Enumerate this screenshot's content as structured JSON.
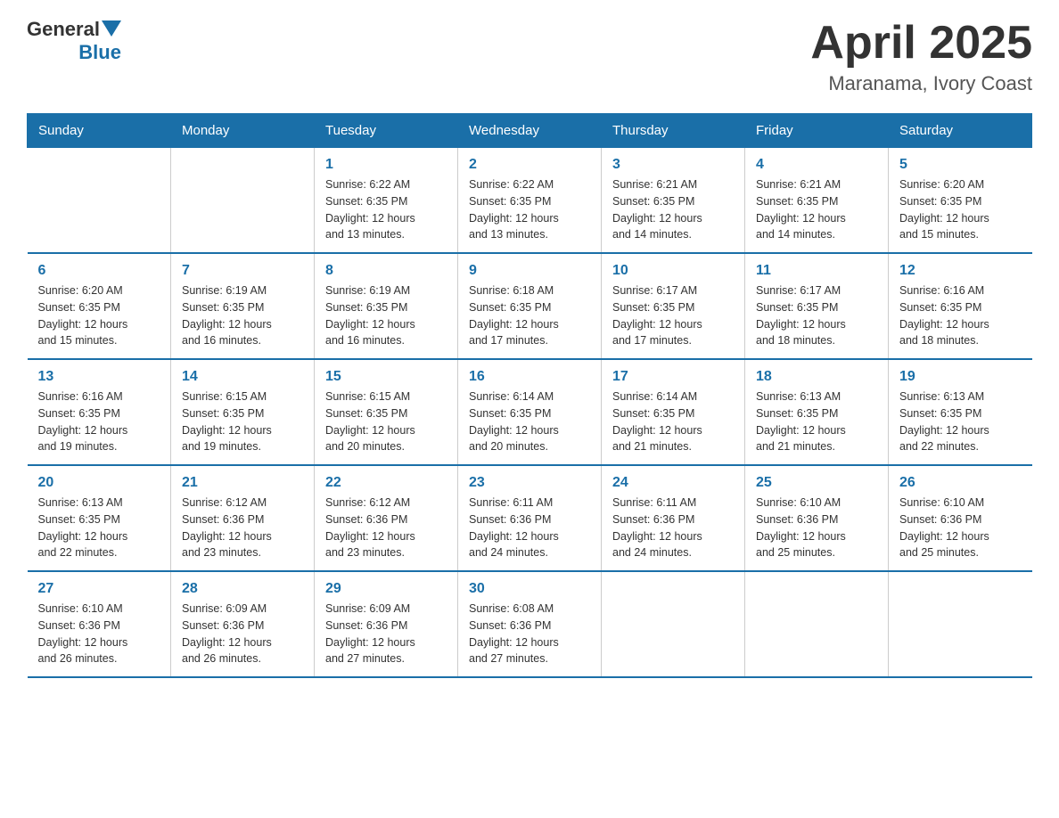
{
  "header": {
    "logo_general": "General",
    "logo_blue": "Blue",
    "month": "April 2025",
    "location": "Maranama, Ivory Coast"
  },
  "weekdays": [
    "Sunday",
    "Monday",
    "Tuesday",
    "Wednesday",
    "Thursday",
    "Friday",
    "Saturday"
  ],
  "weeks": [
    [
      {
        "day": "",
        "info": ""
      },
      {
        "day": "",
        "info": ""
      },
      {
        "day": "1",
        "info": "Sunrise: 6:22 AM\nSunset: 6:35 PM\nDaylight: 12 hours\nand 13 minutes."
      },
      {
        "day": "2",
        "info": "Sunrise: 6:22 AM\nSunset: 6:35 PM\nDaylight: 12 hours\nand 13 minutes."
      },
      {
        "day": "3",
        "info": "Sunrise: 6:21 AM\nSunset: 6:35 PM\nDaylight: 12 hours\nand 14 minutes."
      },
      {
        "day": "4",
        "info": "Sunrise: 6:21 AM\nSunset: 6:35 PM\nDaylight: 12 hours\nand 14 minutes."
      },
      {
        "day": "5",
        "info": "Sunrise: 6:20 AM\nSunset: 6:35 PM\nDaylight: 12 hours\nand 15 minutes."
      }
    ],
    [
      {
        "day": "6",
        "info": "Sunrise: 6:20 AM\nSunset: 6:35 PM\nDaylight: 12 hours\nand 15 minutes."
      },
      {
        "day": "7",
        "info": "Sunrise: 6:19 AM\nSunset: 6:35 PM\nDaylight: 12 hours\nand 16 minutes."
      },
      {
        "day": "8",
        "info": "Sunrise: 6:19 AM\nSunset: 6:35 PM\nDaylight: 12 hours\nand 16 minutes."
      },
      {
        "day": "9",
        "info": "Sunrise: 6:18 AM\nSunset: 6:35 PM\nDaylight: 12 hours\nand 17 minutes."
      },
      {
        "day": "10",
        "info": "Sunrise: 6:17 AM\nSunset: 6:35 PM\nDaylight: 12 hours\nand 17 minutes."
      },
      {
        "day": "11",
        "info": "Sunrise: 6:17 AM\nSunset: 6:35 PM\nDaylight: 12 hours\nand 18 minutes."
      },
      {
        "day": "12",
        "info": "Sunrise: 6:16 AM\nSunset: 6:35 PM\nDaylight: 12 hours\nand 18 minutes."
      }
    ],
    [
      {
        "day": "13",
        "info": "Sunrise: 6:16 AM\nSunset: 6:35 PM\nDaylight: 12 hours\nand 19 minutes."
      },
      {
        "day": "14",
        "info": "Sunrise: 6:15 AM\nSunset: 6:35 PM\nDaylight: 12 hours\nand 19 minutes."
      },
      {
        "day": "15",
        "info": "Sunrise: 6:15 AM\nSunset: 6:35 PM\nDaylight: 12 hours\nand 20 minutes."
      },
      {
        "day": "16",
        "info": "Sunrise: 6:14 AM\nSunset: 6:35 PM\nDaylight: 12 hours\nand 20 minutes."
      },
      {
        "day": "17",
        "info": "Sunrise: 6:14 AM\nSunset: 6:35 PM\nDaylight: 12 hours\nand 21 minutes."
      },
      {
        "day": "18",
        "info": "Sunrise: 6:13 AM\nSunset: 6:35 PM\nDaylight: 12 hours\nand 21 minutes."
      },
      {
        "day": "19",
        "info": "Sunrise: 6:13 AM\nSunset: 6:35 PM\nDaylight: 12 hours\nand 22 minutes."
      }
    ],
    [
      {
        "day": "20",
        "info": "Sunrise: 6:13 AM\nSunset: 6:35 PM\nDaylight: 12 hours\nand 22 minutes."
      },
      {
        "day": "21",
        "info": "Sunrise: 6:12 AM\nSunset: 6:36 PM\nDaylight: 12 hours\nand 23 minutes."
      },
      {
        "day": "22",
        "info": "Sunrise: 6:12 AM\nSunset: 6:36 PM\nDaylight: 12 hours\nand 23 minutes."
      },
      {
        "day": "23",
        "info": "Sunrise: 6:11 AM\nSunset: 6:36 PM\nDaylight: 12 hours\nand 24 minutes."
      },
      {
        "day": "24",
        "info": "Sunrise: 6:11 AM\nSunset: 6:36 PM\nDaylight: 12 hours\nand 24 minutes."
      },
      {
        "day": "25",
        "info": "Sunrise: 6:10 AM\nSunset: 6:36 PM\nDaylight: 12 hours\nand 25 minutes."
      },
      {
        "day": "26",
        "info": "Sunrise: 6:10 AM\nSunset: 6:36 PM\nDaylight: 12 hours\nand 25 minutes."
      }
    ],
    [
      {
        "day": "27",
        "info": "Sunrise: 6:10 AM\nSunset: 6:36 PM\nDaylight: 12 hours\nand 26 minutes."
      },
      {
        "day": "28",
        "info": "Sunrise: 6:09 AM\nSunset: 6:36 PM\nDaylight: 12 hours\nand 26 minutes."
      },
      {
        "day": "29",
        "info": "Sunrise: 6:09 AM\nSunset: 6:36 PM\nDaylight: 12 hours\nand 27 minutes."
      },
      {
        "day": "30",
        "info": "Sunrise: 6:08 AM\nSunset: 6:36 PM\nDaylight: 12 hours\nand 27 minutes."
      },
      {
        "day": "",
        "info": ""
      },
      {
        "day": "",
        "info": ""
      },
      {
        "day": "",
        "info": ""
      }
    ]
  ],
  "colors": {
    "header_bg": "#1a6fa8",
    "accent": "#1a6fa8",
    "text_dark": "#333333",
    "text_medium": "#555555"
  }
}
